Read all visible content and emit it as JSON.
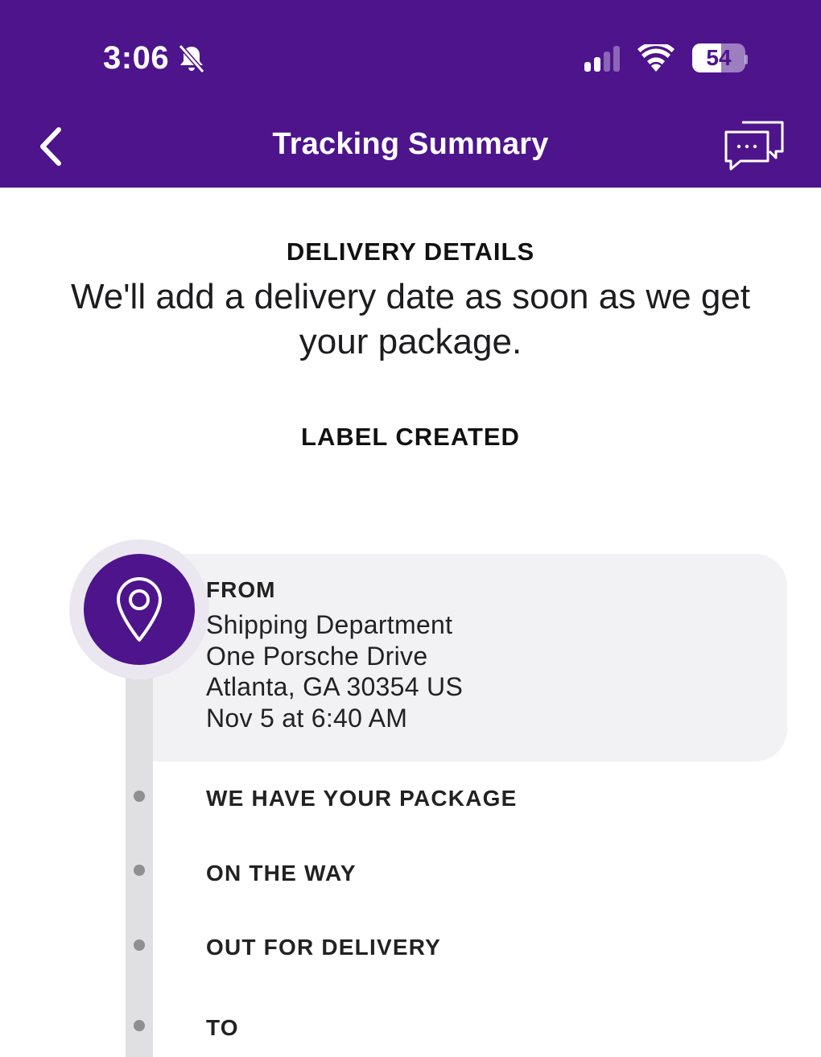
{
  "status_bar": {
    "time": "3:06",
    "battery": "54",
    "battery_level": 0.54
  },
  "nav": {
    "title": "Tracking Summary"
  },
  "delivery": {
    "section_label": "DELIVERY DETAILS",
    "message": "We'll add a delivery date as soon as we get your package.",
    "status": "LABEL CREATED"
  },
  "from": {
    "title": "FROM",
    "lines": [
      "Shipping Department",
      "One Porsche Drive",
      "Atlanta, GA 30354 US",
      "Nov 5 at 6:40 AM"
    ]
  },
  "steps": [
    "WE HAVE YOUR PACKAGE",
    "ON THE WAY",
    "OUT FOR DELIVERY",
    "TO"
  ],
  "colors": {
    "brand_purple": "#4d148c",
    "track_gray": "#e0e0e2",
    "card_gray": "#f2f2f4",
    "dot_gray": "#8e8e93"
  }
}
